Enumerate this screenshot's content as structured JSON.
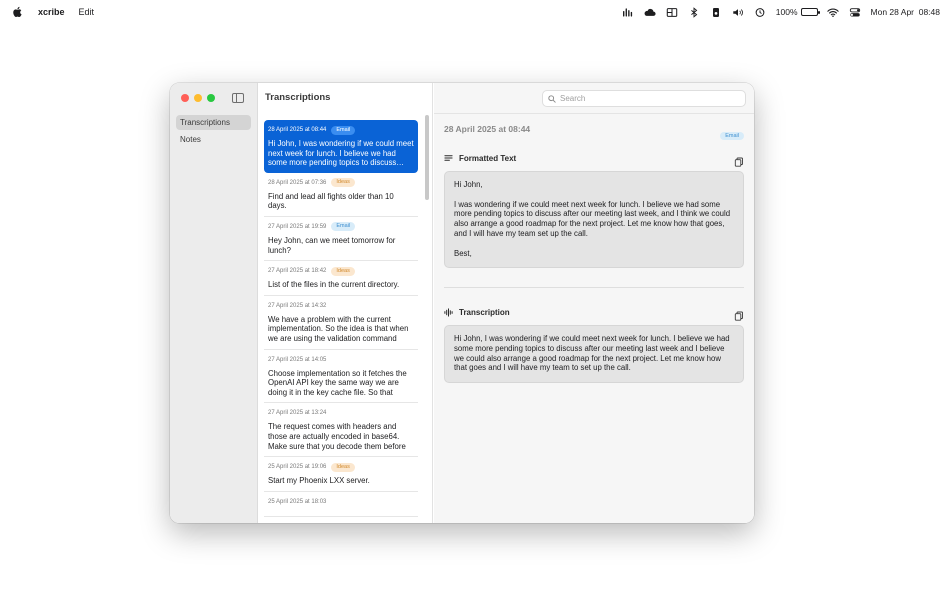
{
  "menubar": {
    "app_name": "xcribe",
    "menus": [
      "Edit"
    ],
    "battery": "100%",
    "datetime": "Mon 28 Apr  08:48",
    "icons": [
      "apple-icon",
      "audio-meter-icon",
      "cloud-icon",
      "window-grid-icon",
      "bluetooth-icon",
      "device-icon",
      "volume-icon",
      "time-machine-icon",
      "battery-icon",
      "wifi-icon",
      "control-center-icon"
    ]
  },
  "sidebar": {
    "items": [
      {
        "label": "Transcriptions",
        "active": true
      },
      {
        "label": "Notes",
        "active": false
      }
    ]
  },
  "list": {
    "title": "Transcriptions",
    "items": [
      {
        "date": "28 April 2025 at 08:44",
        "tag": "Email",
        "text": "Hi John, I was wondering if we could meet next week for lunch. I believe we had some more pending topics to discuss after our meeting last week",
        "selected": true
      },
      {
        "date": "28 April 2025 at 07:36",
        "tag": "Ideas",
        "text": "Find and lead all fights older than 10 days."
      },
      {
        "date": "27 April 2025 at 19:59",
        "tag": "Email",
        "text": "Hey John, can we meet tomorrow for lunch?"
      },
      {
        "date": "27 April 2025 at 18:42",
        "tag": "Ideas",
        "text": "List of the files in the current directory."
      },
      {
        "date": "27 April 2025 at 14:32",
        "tag": "",
        "text": "We have a problem with the current implementation. So the idea is that when we are using the validation command"
      },
      {
        "date": "27 April 2025 at 14:05",
        "tag": "",
        "text": "Choose implementation so it fetches the OpenAI API key the same way we are doing it in the key cache file. So that"
      },
      {
        "date": "27 April 2025 at 13:24",
        "tag": "",
        "text": "The request comes with headers and those are actually encoded in base64. Make sure that you decode them before"
      },
      {
        "date": "25 April 2025 at 19:06",
        "tag": "Ideas",
        "text": "Start my Phoenix LXX server."
      },
      {
        "date": "25 April 2025 at 18:03",
        "tag": "",
        "text": ""
      }
    ]
  },
  "search": {
    "placeholder": "Search",
    "value": ""
  },
  "detail": {
    "date": "28 April 2025 at 08:44",
    "tag": "Email",
    "formatted": {
      "title": "Formatted Text",
      "paragraphs": [
        "Hi John,",
        "I was wondering if we could meet next week for lunch. I believe we had some more pending topics to discuss after our meeting last week, and I think we could also arrange a good roadmap for the next project. Let me know how that goes, and I will have my team set up the call.",
        "Best,"
      ]
    },
    "transcription": {
      "title": "Transcription",
      "text": "Hi John, I was wondering if we could meet next week for lunch. I believe we had some more pending topics to discuss after our meeting last week and I believe we could also arrange a good roadmap for the next project. Let me know how that goes and I will have my team to set up the call."
    }
  },
  "colors": {
    "accent": "#0a63d6",
    "email_badge": "#3f8fcf",
    "ideas_badge": "#d1892c"
  }
}
